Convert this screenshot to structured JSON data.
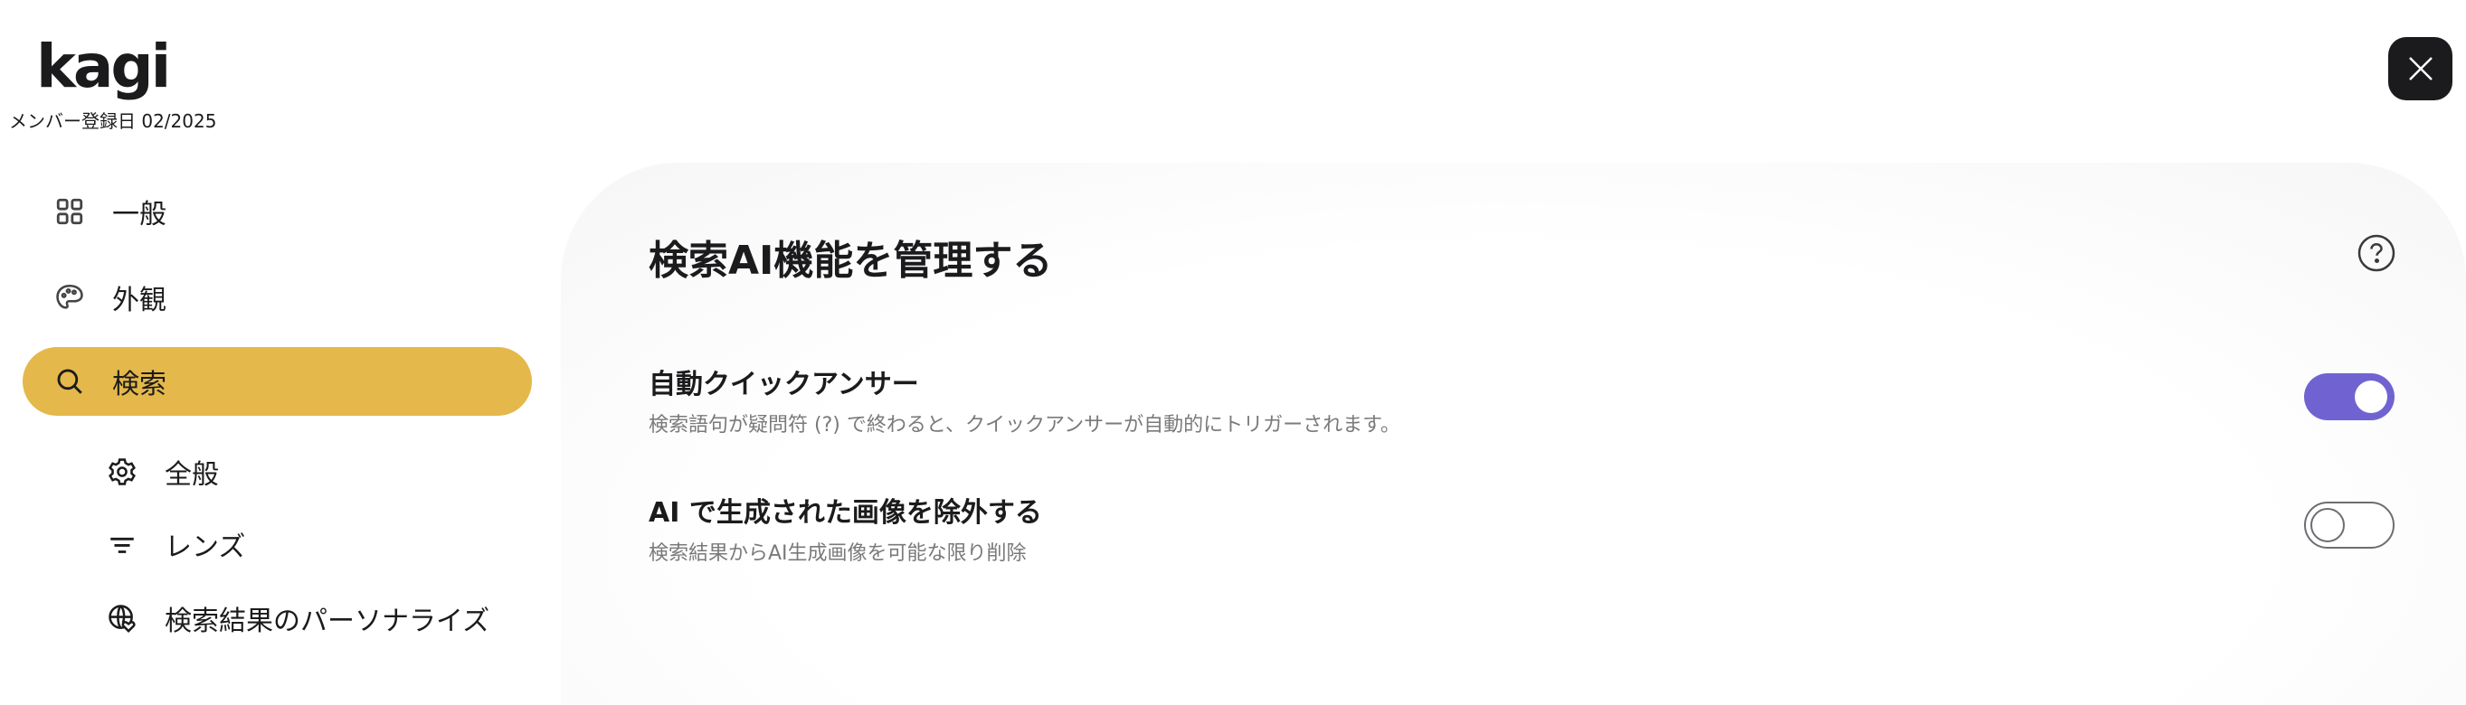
{
  "brand": {
    "logo_text": "kagi",
    "member_since": "メンバー登録日 02/2025"
  },
  "sidebar": {
    "items": [
      {
        "label": "一般",
        "icon": "grid-icon"
      },
      {
        "label": "外観",
        "icon": "palette-icon"
      },
      {
        "label": "検索",
        "icon": "search-icon",
        "active": true,
        "active_color": "#e4b84a"
      }
    ],
    "subitems": [
      {
        "label": "全般",
        "icon": "gear-icon"
      },
      {
        "label": "レンズ",
        "icon": "filter-icon"
      },
      {
        "label": "検索結果のパーソナライズ",
        "icon": "globe-heart-icon"
      }
    ]
  },
  "main": {
    "title": "検索AI機能を管理する",
    "settings": [
      {
        "title": "自動クイックアンサー",
        "description": "検索語句が疑問符 (?) で終わると、クイックアンサーが自動的にトリガーされます。",
        "enabled": true
      },
      {
        "title": "AI で生成された画像を除外する",
        "description": "検索結果からAI生成画像を可能な限り削除",
        "enabled": false
      }
    ],
    "toggle_on_color": "#7063d1"
  }
}
